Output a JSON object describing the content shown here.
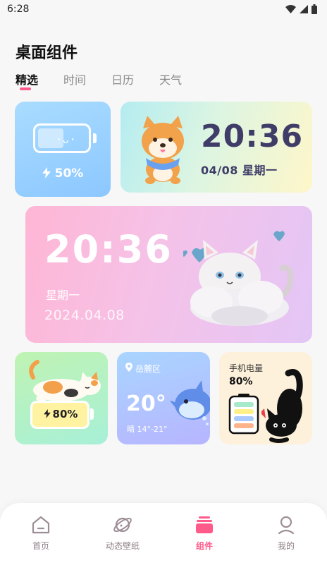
{
  "status_bar": {
    "time": "6:28"
  },
  "page": {
    "title": "桌面组件"
  },
  "tabs": [
    {
      "label": "精选",
      "active": true
    },
    {
      "label": "时间",
      "active": false
    },
    {
      "label": "日历",
      "active": false
    },
    {
      "label": "天气",
      "active": false
    }
  ],
  "battery_widget": {
    "percent": "50%"
  },
  "clock_widget": {
    "time": "20:36",
    "date": "04/08 星期一"
  },
  "big_clock_widget": {
    "time": "20:36",
    "weekday": "星期一",
    "date": "2024.04.08"
  },
  "cat_battery_widget": {
    "percent": "80%"
  },
  "weather_widget": {
    "location": "岳麓区",
    "temperature": "20°",
    "range": "晴 14°-21°"
  },
  "phone_battery_widget": {
    "label": "手机电量",
    "percent": "80%"
  },
  "bottom_nav": [
    {
      "label": "首页",
      "icon": "home-icon",
      "active": false
    },
    {
      "label": "动态壁纸",
      "icon": "planet-icon",
      "active": false
    },
    {
      "label": "组件",
      "icon": "widget-stack-icon",
      "active": true
    },
    {
      "label": "我的",
      "icon": "profile-icon",
      "active": false
    }
  ],
  "colors": {
    "accent": "#ff5a8a",
    "clock_text": "#3f3d68"
  }
}
